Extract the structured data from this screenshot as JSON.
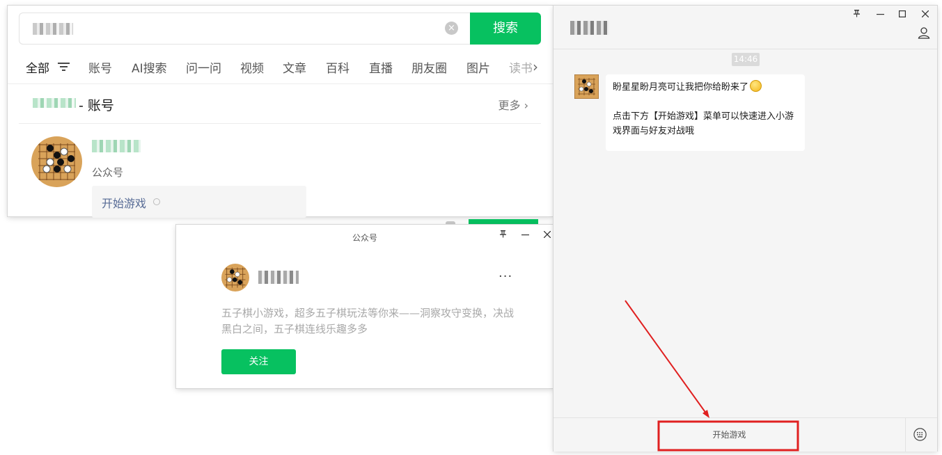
{
  "search_window": {
    "search_button_label": "搜索",
    "clear_symbol": "×",
    "tabs": [
      "全部",
      "账号",
      "AI搜索",
      "问一问",
      "视频",
      "文章",
      "百科",
      "直播",
      "朋友圈",
      "图片",
      "读书"
    ],
    "tab_more_symbol": "›",
    "section_title": "- 账号",
    "section_more": "更多 ›",
    "account_type": "公众号",
    "menu_item": "开始游戏"
  },
  "profile_popup": {
    "title": "公众号",
    "more_symbol": "···",
    "description": "五子棋小游戏，超多五子棋玩法等你来——洞察攻守变换，决战黑白之间，五子棋连线乐趣多多",
    "follow_label": "关注"
  },
  "chat_window": {
    "time": "14:46",
    "message_line1": "盼星星盼月亮可让我把你给盼来了",
    "message_line2": "点击下方【开始游戏】菜单可以快速进入小游戏界面与好友对战哦",
    "menu_label": "开始游戏",
    "window_controls": [
      "⊥",
      "—",
      "☐",
      "✕"
    ]
  },
  "colors": {
    "accent_green": "#07c160",
    "link_blue": "#576b95",
    "highlight_red": "#e02020"
  }
}
